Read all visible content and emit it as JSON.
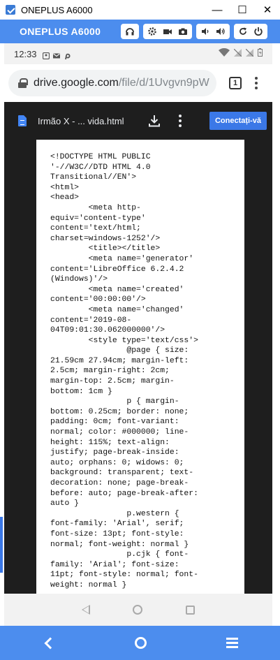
{
  "window": {
    "title": "ONEPLUS A6000",
    "minimize": "—",
    "maximize": "☐",
    "close": "✕"
  },
  "emulator": {
    "title": "ONEPLUS A6000",
    "tools": [
      "headset-icon",
      "gear-icon",
      "camera-video-icon",
      "camera-icon",
      "volume-down-icon",
      "volume-up-icon",
      "rotate-icon",
      "power-icon"
    ]
  },
  "status_bar": {
    "time": "12:33"
  },
  "browser": {
    "url_host": "drive.google.com",
    "url_path": "/file/d/1Uvgvn9pW",
    "tab_count": "1"
  },
  "viewer": {
    "file_name": "Irmão X - ... vida.html",
    "connect_label": "Conectați-vă",
    "code_lines": [
      "<!DOCTYPE HTML PUBLIC",
      "'-//W3C//DTD HTML 4.0",
      "Transitional//EN'>",
      "<html>",
      "<head>",
      "        <meta http-",
      "equiv='content-type'",
      "content='text/html;",
      "charset=windows-1252'/>",
      "        <title></title>",
      "        <meta name='generator'",
      "content='LibreOffice 6.2.4.2",
      "(Windows)'/>",
      "        <meta name='created'",
      "content='00:00:00'/>",
      "        <meta name='changed'",
      "content='2019-08-",
      "04T09:01:30.062000000'/>",
      "        <style type='text/css'>",
      "                @page { size:",
      "21.59cm 27.94cm; margin-left:",
      "2.5cm; margin-right: 2cm;",
      "margin-top: 2.5cm; margin-",
      "bottom: 1cm }",
      "                p { margin-",
      "bottom: 0.25cm; border: none;",
      "padding: 0cm; font-variant:",
      "normal; color: #000000; line-",
      "height: 115%; text-align:",
      "justify; page-break-inside:",
      "auto; orphans: 0; widows: 0;",
      "background: transparent; text-",
      "decoration: none; page-break-",
      "before: auto; page-break-after:",
      "auto }",
      "                p.western {",
      "font-family: 'Arial', serif;",
      "font-size: 13pt; font-style:",
      "normal; font-weight: normal }",
      "                p.cjk { font-",
      "family: 'Arial'; font-size:",
      "11pt; font-style: normal; font-",
      "weight: normal }"
    ]
  }
}
